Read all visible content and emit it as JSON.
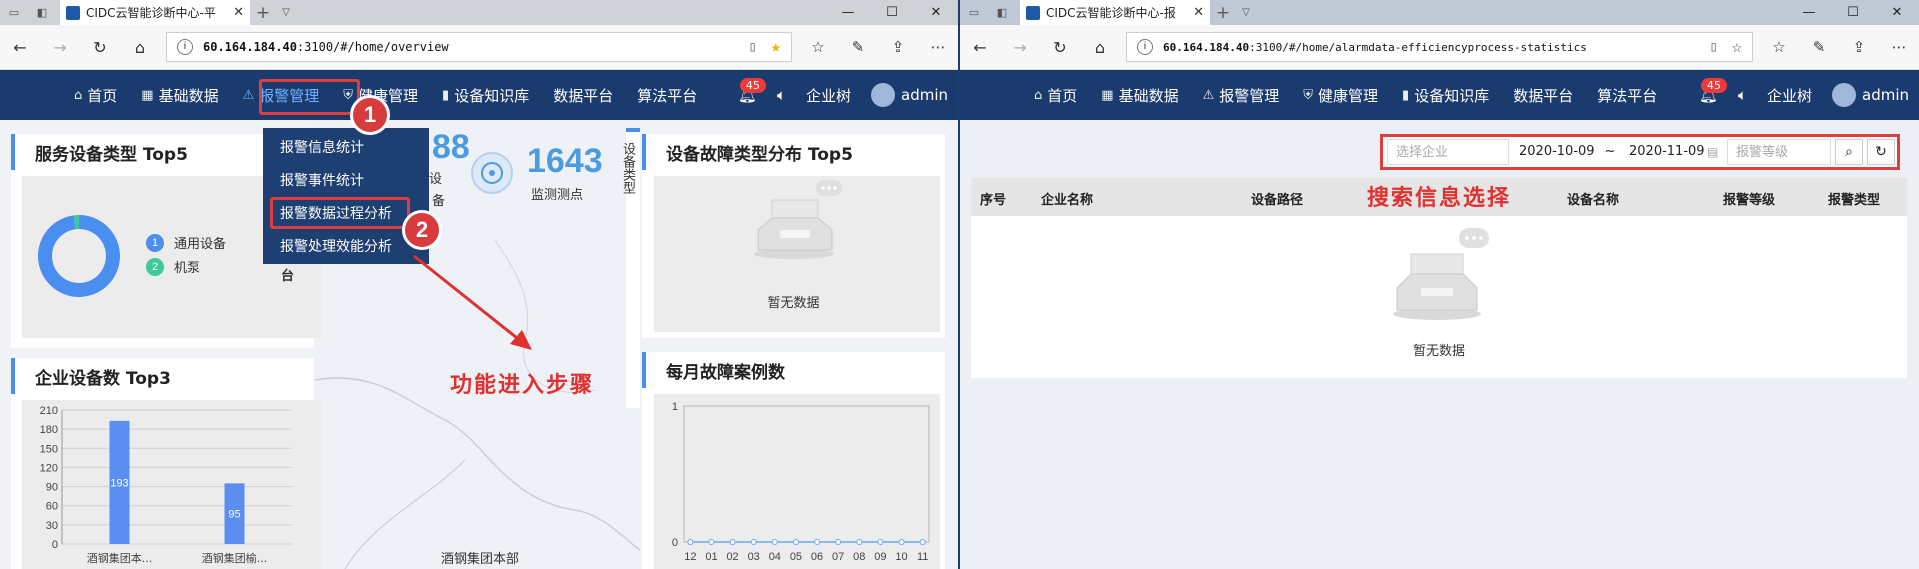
{
  "left": {
    "tab_title": "CIDC云智能诊断中心-平",
    "url_host": "60.164.184.40",
    "url_path": ":3100/#/home/overview",
    "nav": [
      "首页",
      "基础数据",
      "报警管理",
      "健康管理",
      "设备知识库",
      "数据平台",
      "算法平台"
    ],
    "badge": "45",
    "company": "企业树",
    "user": "admin",
    "dropdown": [
      "报警信息统计",
      "报警事件统计",
      "报警数据过程分析",
      "报警处理效能分析"
    ],
    "step1": "1",
    "step2": "2",
    "annotation": "功能进入步骤",
    "card_service": "服务设备类型 Top5",
    "legend": [
      {
        "num": "1",
        "label": "通用设备",
        "color": "#4a8ff0"
      },
      {
        "num": "2",
        "label": "机泵",
        "color": "#3dc99a"
      }
    ],
    "legend_value": "4台",
    "stat1_num": "88",
    "stat1_lbl_a": "务设",
    "stat1_lbl_b": "备",
    "stat2_num": "1643",
    "stat2_lbl": "监测测点",
    "card_fault": "设备故障类型分布 Top5",
    "side_text": "设备类型",
    "nodata": "暂无数据",
    "card_top3": "企业设备数 Top3",
    "card_monthly": "每月故障案例数",
    "map_label": "酒钢集团本部"
  },
  "right": {
    "tab_title": "CIDC云智能诊断中心-报",
    "url_host": "60.164.184.40",
    "url_path": ":3100/#/home/alarmdata-efficiencyprocess-statistics",
    "nav": [
      "首页",
      "基础数据",
      "报警管理",
      "健康管理",
      "设备知识库",
      "数据平台",
      "算法平台"
    ],
    "badge": "45",
    "company": "企业树",
    "user": "admin",
    "company_placeholder": "选择企业",
    "date_start": "2020-10-09",
    "date_sep": "~",
    "date_end": "2020-11-09",
    "level_placeholder": "报警等级",
    "annotation": "搜索信息选择",
    "columns": [
      "序号",
      "企业名称",
      "设备路径",
      "设备名称",
      "报警等级",
      "报警类型"
    ],
    "nodata": "暂无数据"
  },
  "bar_chart": {
    "type": "bar",
    "categories": [
      "酒钢集团本...",
      "酒钢集团榆..."
    ],
    "values": [
      193,
      95
    ],
    "yticks": [
      "210",
      "180",
      "150",
      "120",
      "90",
      "60",
      "30",
      "0"
    ],
    "ylim": [
      0,
      210
    ],
    "color": "#5a8ff0"
  },
  "line_chart": {
    "type": "line",
    "categories": [
      "12",
      "01",
      "02",
      "03",
      "04",
      "05",
      "06",
      "07",
      "08",
      "09",
      "10",
      "11"
    ],
    "values": [
      0,
      0,
      0,
      0,
      0,
      0,
      0,
      0,
      0,
      0,
      0,
      0
    ],
    "yticks": [
      "1",
      "0"
    ],
    "ylim": [
      0,
      1
    ],
    "color": "#6aa8f0"
  },
  "donut": {
    "type": "pie",
    "values": [
      98,
      2
    ],
    "colors": [
      "#4a8ff0",
      "#3dc99a"
    ]
  }
}
